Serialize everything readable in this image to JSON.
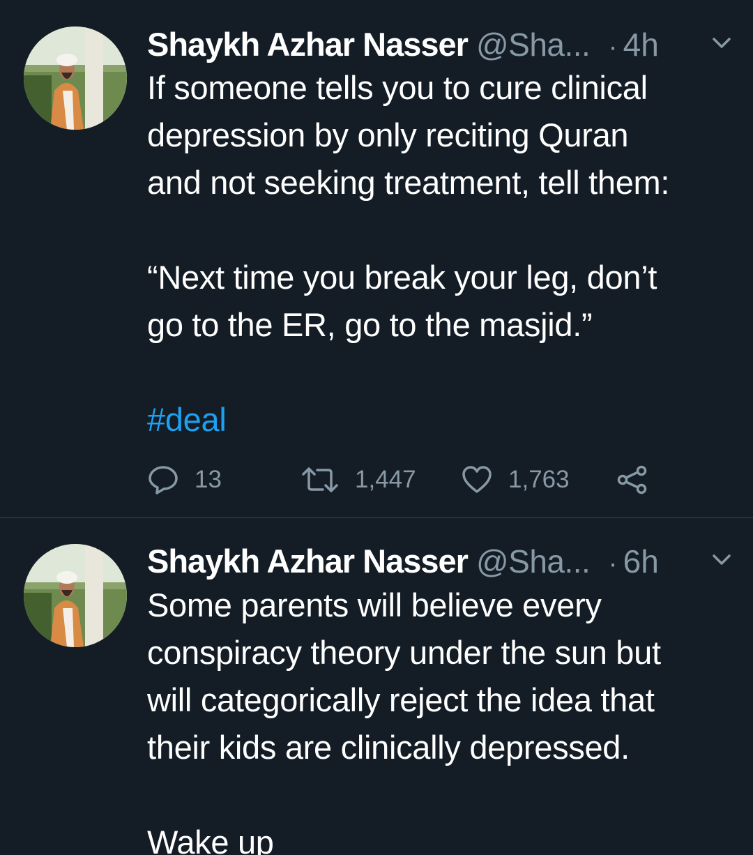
{
  "colors": {
    "background": "#141d26",
    "text": "#ffffff",
    "secondary": "#8899a6",
    "link": "#1da1f2",
    "divider": "#38444d"
  },
  "tweets": [
    {
      "author_name": "Shaykh Azhar Nasser",
      "handle": "@Sha...",
      "separator": "·",
      "time": "4h",
      "lines": [
        "If someone tells you to cure clinical",
        "depression by only reciting Quran",
        "and not seeking treatment, tell them:",
        "",
        "“Next time you break your leg, don’t",
        "go to the ER, go to the masjid.”",
        ""
      ],
      "hashtag": "#deal",
      "actions": {
        "replies": "13",
        "retweets": "1,447",
        "likes": "1,763"
      }
    },
    {
      "author_name": "Shaykh Azhar Nasser",
      "handle": "@Sha...",
      "separator": "·",
      "time": "6h",
      "lines": [
        "Some parents will believe every",
        "conspiracy theory under the sun but",
        "will categorically reject the idea that",
        "their kids are clinically depressed.",
        "",
        "Wake up"
      ]
    }
  ],
  "icons": {
    "reply": "reply-icon",
    "retweet": "retweet-icon",
    "like": "heart-icon",
    "share": "share-icon",
    "menu": "chevron-down-icon"
  }
}
